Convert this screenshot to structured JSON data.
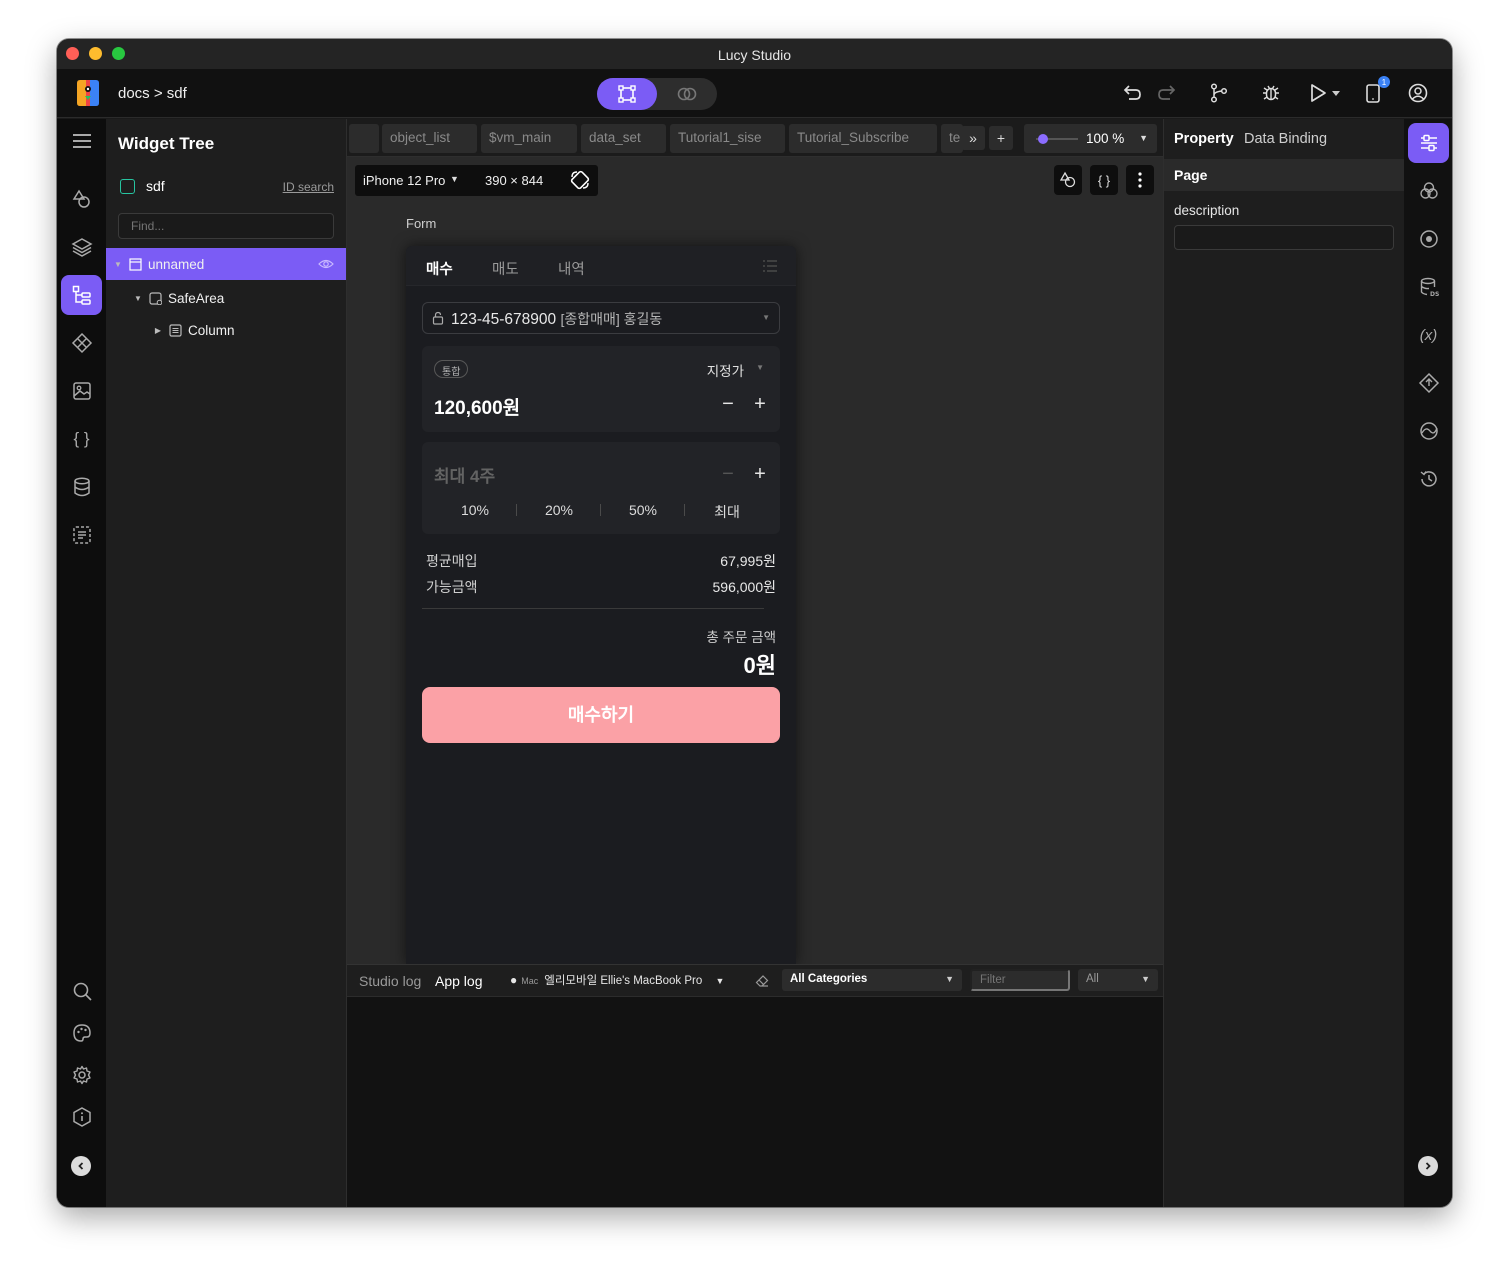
{
  "window": {
    "title": "Lucy Studio"
  },
  "toolbar": {
    "breadcrumb": "docs > sdf",
    "notification_count": "1",
    "accent_color": "#7b5cf5"
  },
  "widget_tree": {
    "title": "Widget Tree",
    "page_name": "sdf",
    "id_search": "ID search",
    "find_placeholder": "Find...",
    "nodes": [
      {
        "label": "unnamed",
        "icon": "frame-icon"
      },
      {
        "label": "SafeArea",
        "icon": "safearea-icon"
      },
      {
        "label": "Column",
        "icon": "column-icon"
      }
    ]
  },
  "editor_tabs": [
    "object_list",
    "$vm_main",
    "data_set",
    "Tutorial1_sise",
    "Tutorial_Subscribe",
    "te"
  ],
  "zoom": {
    "value": "100 %"
  },
  "device": {
    "name": "iPhone 12 Pro",
    "size": "390 × 844"
  },
  "canvas": {
    "form_label": "Form",
    "tabs": [
      "매수",
      "매도",
      "내역"
    ],
    "account": {
      "number": "123-45-678900",
      "detail": "[종합매매] 홍길동"
    },
    "price": {
      "badge": "통합",
      "order_type": "지정가",
      "value": "120,600원"
    },
    "quantity": {
      "placeholder": "최대 4주",
      "percentages": [
        "10%",
        "20%",
        "50%",
        "최대"
      ]
    },
    "info": [
      {
        "label": "평균매입",
        "value": "67,995원"
      },
      {
        "label": "가능금액",
        "value": "596,000원"
      }
    ],
    "total": {
      "label": "총 주문 금액",
      "value": "0원"
    },
    "buy_button": "매수하기",
    "buy_button_color": "#fba1a6"
  },
  "log": {
    "tabs": [
      "Studio log",
      "App log"
    ],
    "platform": "Mac",
    "device": "엘리모바일 Ellie's MacBook Pro",
    "category": "All Categories",
    "filter_placeholder": "Filter",
    "level": "All"
  },
  "properties": {
    "tabs": [
      "Property",
      "Data Binding"
    ],
    "section": "Page",
    "field_label": "description",
    "field_value": ""
  }
}
